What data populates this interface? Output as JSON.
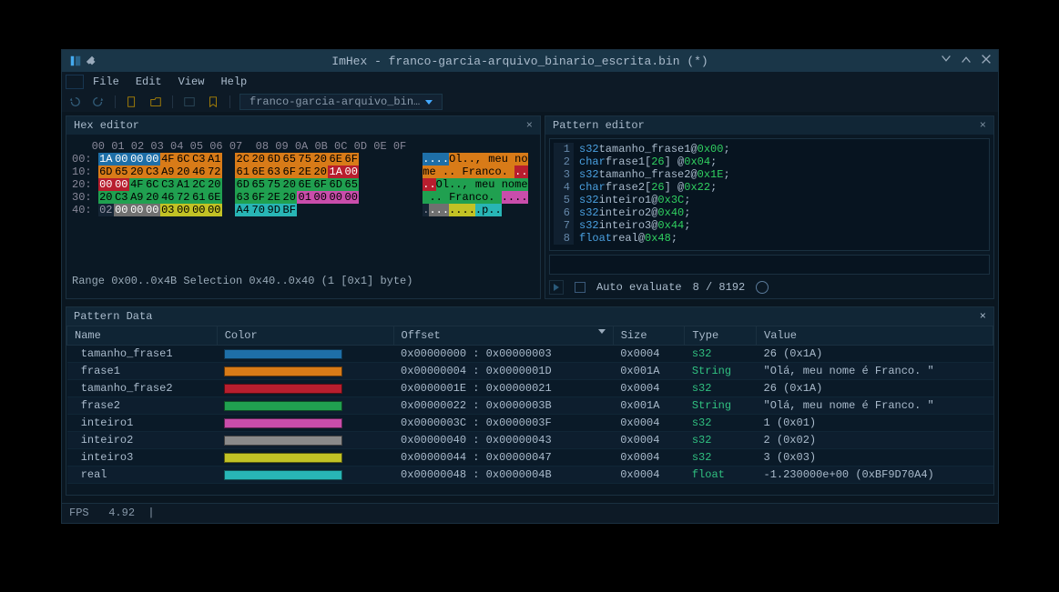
{
  "title": "ImHex - franco-garcia-arquivo_binario_escrita.bin (*)",
  "menubar": [
    "File",
    "Edit",
    "View",
    "Help"
  ],
  "toolbar": {
    "filename": "franco-garcia-arquivo_bin…"
  },
  "hex": {
    "title": "Hex editor",
    "col_header": "   00 01 02 03 04 05 06 07  08 09 0A 0B 0C 0D 0E 0F",
    "rows": [
      {
        "off": "00:",
        "cells": [
          {
            "t": "1A",
            "c": 0
          },
          {
            "t": "00",
            "c": 0
          },
          {
            "t": "00",
            "c": 0
          },
          {
            "t": "00",
            "c": 0
          },
          {
            "t": "4F",
            "c": 1
          },
          {
            "t": "6C",
            "c": 1
          },
          {
            "t": "C3",
            "c": 1
          },
          {
            "t": "A1",
            "c": 1
          },
          {
            "t": "2C",
            "c": 1
          },
          {
            "t": "20",
            "c": 1
          },
          {
            "t": "6D",
            "c": 1
          },
          {
            "t": "65",
            "c": 1
          },
          {
            "t": "75",
            "c": 1
          },
          {
            "t": "20",
            "c": 1
          },
          {
            "t": "6E",
            "c": 1
          },
          {
            "t": "6F",
            "c": 1
          }
        ],
        "ascii": [
          {
            "t": ".",
            "c": 0
          },
          {
            "t": ".",
            "c": 0
          },
          {
            "t": ".",
            "c": 0
          },
          {
            "t": ".",
            "c": 0
          },
          {
            "t": "O",
            "c": 1
          },
          {
            "t": "l",
            "c": 1
          },
          {
            "t": ".",
            "c": 1
          },
          {
            "t": ".",
            "c": 1
          },
          {
            "t": ",",
            "c": 1
          },
          {
            "t": " ",
            "c": 1
          },
          {
            "t": "m",
            "c": 1
          },
          {
            "t": "e",
            "c": 1
          },
          {
            "t": "u",
            "c": 1
          },
          {
            "t": " ",
            "c": 1
          },
          {
            "t": "n",
            "c": 1
          },
          {
            "t": "o",
            "c": 1
          }
        ]
      },
      {
        "off": "10:",
        "cells": [
          {
            "t": "6D",
            "c": 1
          },
          {
            "t": "65",
            "c": 1
          },
          {
            "t": "20",
            "c": 1
          },
          {
            "t": "C3",
            "c": 1
          },
          {
            "t": "A9",
            "c": 1
          },
          {
            "t": "20",
            "c": 1
          },
          {
            "t": "46",
            "c": 1
          },
          {
            "t": "72",
            "c": 1
          },
          {
            "t": "61",
            "c": 1
          },
          {
            "t": "6E",
            "c": 1
          },
          {
            "t": "63",
            "c": 1
          },
          {
            "t": "6F",
            "c": 1
          },
          {
            "t": "2E",
            "c": 1
          },
          {
            "t": "20",
            "c": 1
          },
          {
            "t": "1A",
            "c": 2
          },
          {
            "t": "00",
            "c": 2
          }
        ],
        "ascii": [
          {
            "t": "m",
            "c": 1
          },
          {
            "t": "e",
            "c": 1
          },
          {
            "t": " ",
            "c": 1
          },
          {
            "t": ".",
            "c": 1
          },
          {
            "t": ".",
            "c": 1
          },
          {
            "t": " ",
            "c": 1
          },
          {
            "t": "F",
            "c": 1
          },
          {
            "t": "r",
            "c": 1
          },
          {
            "t": "a",
            "c": 1
          },
          {
            "t": "n",
            "c": 1
          },
          {
            "t": "c",
            "c": 1
          },
          {
            "t": "o",
            "c": 1
          },
          {
            "t": ".",
            "c": 1
          },
          {
            "t": " ",
            "c": 1
          },
          {
            "t": ".",
            "c": 2
          },
          {
            "t": ".",
            "c": 2
          }
        ]
      },
      {
        "off": "20:",
        "cells": [
          {
            "t": "00",
            "c": 2
          },
          {
            "t": "00",
            "c": 2
          },
          {
            "t": "4F",
            "c": 3
          },
          {
            "t": "6C",
            "c": 3
          },
          {
            "t": "C3",
            "c": 3
          },
          {
            "t": "A1",
            "c": 3
          },
          {
            "t": "2C",
            "c": 3
          },
          {
            "t": "20",
            "c": 3
          },
          {
            "t": "6D",
            "c": 3
          },
          {
            "t": "65",
            "c": 3
          },
          {
            "t": "75",
            "c": 3
          },
          {
            "t": "20",
            "c": 3
          },
          {
            "t": "6E",
            "c": 3
          },
          {
            "t": "6F",
            "c": 3
          },
          {
            "t": "6D",
            "c": 3
          },
          {
            "t": "65",
            "c": 3
          }
        ],
        "ascii": [
          {
            "t": ".",
            "c": 2
          },
          {
            "t": ".",
            "c": 2
          },
          {
            "t": "O",
            "c": 3
          },
          {
            "t": "l",
            "c": 3
          },
          {
            "t": ".",
            "c": 3
          },
          {
            "t": ".",
            "c": 3
          },
          {
            "t": ",",
            "c": 3
          },
          {
            "t": " ",
            "c": 3
          },
          {
            "t": "m",
            "c": 3
          },
          {
            "t": "e",
            "c": 3
          },
          {
            "t": "u",
            "c": 3
          },
          {
            "t": " ",
            "c": 3
          },
          {
            "t": "n",
            "c": 3
          },
          {
            "t": "o",
            "c": 3
          },
          {
            "t": "m",
            "c": 3
          },
          {
            "t": "e",
            "c": 3
          }
        ]
      },
      {
        "off": "30:",
        "cells": [
          {
            "t": "20",
            "c": 3
          },
          {
            "t": "C3",
            "c": 3
          },
          {
            "t": "A9",
            "c": 3
          },
          {
            "t": "20",
            "c": 3
          },
          {
            "t": "46",
            "c": 3
          },
          {
            "t": "72",
            "c": 3
          },
          {
            "t": "61",
            "c": 3
          },
          {
            "t": "6E",
            "c": 3
          },
          {
            "t": "63",
            "c": 3
          },
          {
            "t": "6F",
            "c": 3
          },
          {
            "t": "2E",
            "c": 3
          },
          {
            "t": "20",
            "c": 3
          },
          {
            "t": "01",
            "c": 4
          },
          {
            "t": "00",
            "c": 4
          },
          {
            "t": "00",
            "c": 4
          },
          {
            "t": "00",
            "c": 4
          }
        ],
        "ascii": [
          {
            "t": " ",
            "c": 3
          },
          {
            "t": ".",
            "c": 3
          },
          {
            "t": ".",
            "c": 3
          },
          {
            "t": " ",
            "c": 3
          },
          {
            "t": "F",
            "c": 3
          },
          {
            "t": "r",
            "c": 3
          },
          {
            "t": "a",
            "c": 3
          },
          {
            "t": "n",
            "c": 3
          },
          {
            "t": "c",
            "c": 3
          },
          {
            "t": "o",
            "c": 3
          },
          {
            "t": ".",
            "c": 3
          },
          {
            "t": " ",
            "c": 3
          },
          {
            "t": ".",
            "c": 4
          },
          {
            "t": ".",
            "c": 4
          },
          {
            "t": ".",
            "c": 4
          },
          {
            "t": ".",
            "c": 4
          }
        ]
      },
      {
        "off": "40:",
        "cells": [
          {
            "t": "02",
            "c": 8
          },
          {
            "t": "00",
            "c": 5
          },
          {
            "t": "00",
            "c": 5
          },
          {
            "t": "00",
            "c": 5
          },
          {
            "t": "03",
            "c": 6
          },
          {
            "t": "00",
            "c": 6
          },
          {
            "t": "00",
            "c": 6
          },
          {
            "t": "00",
            "c": 6
          },
          {
            "t": "A4",
            "c": 7
          },
          {
            "t": "70",
            "c": 7
          },
          {
            "t": "9D",
            "c": 7
          },
          {
            "t": "BF",
            "c": 7
          }
        ],
        "ascii": [
          {
            "t": ".",
            "c": 8
          },
          {
            "t": ".",
            "c": 5
          },
          {
            "t": ".",
            "c": 5
          },
          {
            "t": ".",
            "c": 5
          },
          {
            "t": ".",
            "c": 6
          },
          {
            "t": ".",
            "c": 6
          },
          {
            "t": ".",
            "c": 6
          },
          {
            "t": ".",
            "c": 6
          },
          {
            "t": ".",
            "c": 7
          },
          {
            "t": "p",
            "c": 7
          },
          {
            "t": ".",
            "c": 7
          },
          {
            "t": ".",
            "c": 7
          }
        ]
      }
    ],
    "status": "Range 0x00..0x4B  Selection 0x40..0x40 (1 [0x1] byte)"
  },
  "pattern_editor": {
    "title": "Pattern editor",
    "lines": [
      [
        {
          "t": "s32",
          "c": "kw-type"
        },
        {
          "t": " "
        },
        {
          "t": "tamanho_frase1",
          "c": "kw-name"
        },
        {
          "t": " @ "
        },
        {
          "t": "0x00",
          "c": "kw-hex"
        },
        {
          "t": ";"
        }
      ],
      [
        {
          "t": "char",
          "c": "kw-type"
        },
        {
          "t": " "
        },
        {
          "t": "frase1",
          "c": "kw-name"
        },
        {
          "t": "["
        },
        {
          "t": "26",
          "c": "kw-num"
        },
        {
          "t": "] @ "
        },
        {
          "t": "0x04",
          "c": "kw-hex"
        },
        {
          "t": ";"
        }
      ],
      [
        {
          "t": "s32",
          "c": "kw-type"
        },
        {
          "t": " "
        },
        {
          "t": "tamanho_frase2",
          "c": "kw-name"
        },
        {
          "t": " @ "
        },
        {
          "t": "0x1E",
          "c": "kw-hex"
        },
        {
          "t": ";"
        }
      ],
      [
        {
          "t": "char",
          "c": "kw-type"
        },
        {
          "t": " "
        },
        {
          "t": "frase2",
          "c": "kw-name"
        },
        {
          "t": "["
        },
        {
          "t": "26",
          "c": "kw-num"
        },
        {
          "t": "] @ "
        },
        {
          "t": "0x22",
          "c": "kw-hex"
        },
        {
          "t": ";"
        }
      ],
      [
        {
          "t": "s32",
          "c": "kw-type"
        },
        {
          "t": " "
        },
        {
          "t": "inteiro1",
          "c": "kw-name"
        },
        {
          "t": " @ "
        },
        {
          "t": "0x3C",
          "c": "kw-hex"
        },
        {
          "t": ";"
        }
      ],
      [
        {
          "t": "s32",
          "c": "kw-type"
        },
        {
          "t": " "
        },
        {
          "t": "inteiro2",
          "c": "kw-name"
        },
        {
          "t": " @ "
        },
        {
          "t": "0x40",
          "c": "kw-hex"
        },
        {
          "t": ";"
        }
      ],
      [
        {
          "t": "s32",
          "c": "kw-type"
        },
        {
          "t": " "
        },
        {
          "t": "inteiro3",
          "c": "kw-name"
        },
        {
          "t": " @ "
        },
        {
          "t": "0x44",
          "c": "kw-hex"
        },
        {
          "t": ";"
        }
      ],
      [
        {
          "t": "float",
          "c": "kw-type"
        },
        {
          "t": " "
        },
        {
          "t": "real",
          "c": "kw-name"
        },
        {
          "t": " @"
        },
        {
          "t": "0x48",
          "c": "kw-hex"
        },
        {
          "t": ";"
        }
      ]
    ],
    "auto_eval_label": "Auto evaluate",
    "counter": "8 / 8192"
  },
  "pattern_data": {
    "title": "Pattern Data",
    "columns": [
      "Name",
      "Color",
      "Offset",
      "Size",
      "Type",
      "Value"
    ],
    "rows": [
      {
        "name": "tamanho_frase1",
        "color": "#1E6FA8",
        "offset": "0x00000000 : 0x00000003",
        "size": "0x0004",
        "type": "s32",
        "value": "26 (0x1A)"
      },
      {
        "name": "frase1",
        "color": "#D87B18",
        "offset": "0x00000004 : 0x0000001D",
        "size": "0x001A",
        "type": "String",
        "value": "\"Olá, meu nome é Franco. \""
      },
      {
        "name": "tamanho_frase2",
        "color": "#B81E2E",
        "offset": "0x0000001E : 0x00000021",
        "size": "0x0004",
        "type": "s32",
        "value": "26 (0x1A)"
      },
      {
        "name": "frase2",
        "color": "#20A050",
        "offset": "0x00000022 : 0x0000003B",
        "size": "0x001A",
        "type": "String",
        "value": "\"Olá, meu nome é Franco. \""
      },
      {
        "name": "inteiro1",
        "color": "#C94DAB",
        "offset": "0x0000003C : 0x0000003F",
        "size": "0x0004",
        "type": "s32",
        "value": "1 (0x01)"
      },
      {
        "name": "inteiro2",
        "color": "#8a8a8a",
        "offset": "0x00000040 : 0x00000043",
        "size": "0x0004",
        "type": "s32",
        "value": "2 (0x02)"
      },
      {
        "name": "inteiro3",
        "color": "#C2C225",
        "offset": "0x00000044 : 0x00000047",
        "size": "0x0004",
        "type": "s32",
        "value": "3 (0x03)"
      },
      {
        "name": "real",
        "color": "#28B5B5",
        "offset": "0x00000048 : 0x0000004B",
        "size": "0x0004",
        "type": "float",
        "value": "-1.230000e+00 (0xBF9D70A4)"
      }
    ]
  },
  "status": {
    "fps_label": "FPS",
    "fps_value": "4.92"
  }
}
